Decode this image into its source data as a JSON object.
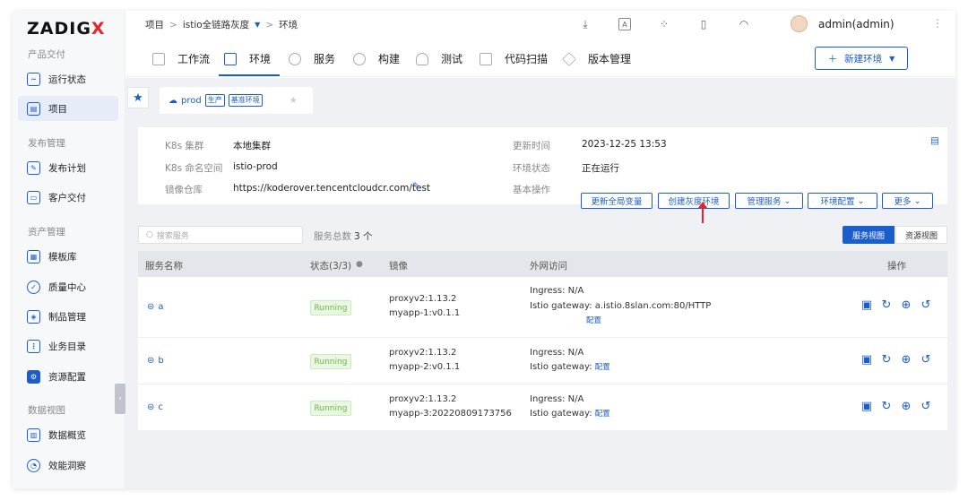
{
  "logo": {
    "text": "ZADIG",
    "accent": "X"
  },
  "sidebar": {
    "sections": [
      {
        "title": "产品交付",
        "items": [
          {
            "label": "运行状态",
            "icon": "pulse-icon"
          },
          {
            "label": "项目",
            "icon": "project-icon",
            "active": true
          }
        ]
      },
      {
        "title": "发布管理",
        "items": [
          {
            "label": "发布计划",
            "icon": "release-plan-icon"
          },
          {
            "label": "客户交付",
            "icon": "delivery-icon"
          }
        ]
      },
      {
        "title": "资产管理",
        "items": [
          {
            "label": "模板库",
            "icon": "template-icon"
          },
          {
            "label": "质量中心",
            "icon": "quality-icon"
          },
          {
            "label": "制品管理",
            "icon": "artifact-icon"
          },
          {
            "label": "业务目录",
            "icon": "catalog-icon"
          },
          {
            "label": "资源配置",
            "icon": "resource-icon"
          }
        ]
      },
      {
        "title": "数据视图",
        "items": [
          {
            "label": "数据概览",
            "icon": "chart-icon"
          },
          {
            "label": "效能洞察",
            "icon": "insight-icon"
          }
        ]
      }
    ]
  },
  "breadcrumb": {
    "root": "项目",
    "project": "istio全链路灰度",
    "page": "环境"
  },
  "user": {
    "name": "admin(admin)"
  },
  "tabs": [
    {
      "label": "工作流"
    },
    {
      "label": "环境",
      "active": true
    },
    {
      "label": "服务"
    },
    {
      "label": "构建"
    },
    {
      "label": "测试"
    },
    {
      "label": "代码扫描"
    },
    {
      "label": "版本管理"
    }
  ],
  "new_env_label": "新建环境",
  "env_tab": {
    "name": "prod",
    "badge1": "生产",
    "badge2": "基准环境"
  },
  "env_info": {
    "cluster_label": "K8s 集群",
    "cluster": "本地集群",
    "ns_label": "K8s 命名空间",
    "ns": "istio-prod",
    "registry_label": "镜像仓库",
    "registry": "https://koderover.tencentcloudcr.com/test",
    "update_label": "更新时间",
    "update": "2023-12-25 13:53",
    "status_label": "环境状态",
    "status": "正在运行",
    "ops_label": "基本操作"
  },
  "ops": {
    "update_vars": "更新全局变量",
    "create_gray": "创建灰度环境",
    "manage_svc": "管理服务",
    "env_config": "环境配置",
    "more": "更多"
  },
  "search": {
    "placeholder": "搜索服务"
  },
  "total": {
    "label": "服务总数",
    "count": "3 个"
  },
  "views": {
    "service": "服务视图",
    "resource": "资源视图"
  },
  "table": {
    "headers": {
      "name": "服务名称",
      "status": "状态(3/3)",
      "image": "镜像",
      "access": "外网访问",
      "ops": "操作"
    },
    "rows": [
      {
        "name": "a",
        "status": "Running",
        "image1": "proxyv2:1.13.2",
        "image2": "myapp-1:v0.1.1",
        "ingress": "Ingress: N/A",
        "gateway_label": "Istio gateway:",
        "gateway_value": "a.istio.8slan.com:80/HTTP",
        "config": "配置"
      },
      {
        "name": "b",
        "status": "Running",
        "image1": "proxyv2:1.13.2",
        "image2": "myapp-2:v0.1.1",
        "ingress": "Ingress: N/A",
        "gateway_label": "Istio gateway:",
        "gateway_value": "",
        "config": "配置"
      },
      {
        "name": "c",
        "status": "Running",
        "image1": "proxyv2:1.13.2",
        "image2": "myapp-3:20220809173756",
        "ingress": "Ingress: N/A",
        "gateway_label": "Istio gateway:",
        "gateway_value": "",
        "config": "配置"
      }
    ]
  },
  "colors": {
    "primary": "#1b5dc9",
    "accent": "#e8232b",
    "running": "#6bb64a"
  }
}
